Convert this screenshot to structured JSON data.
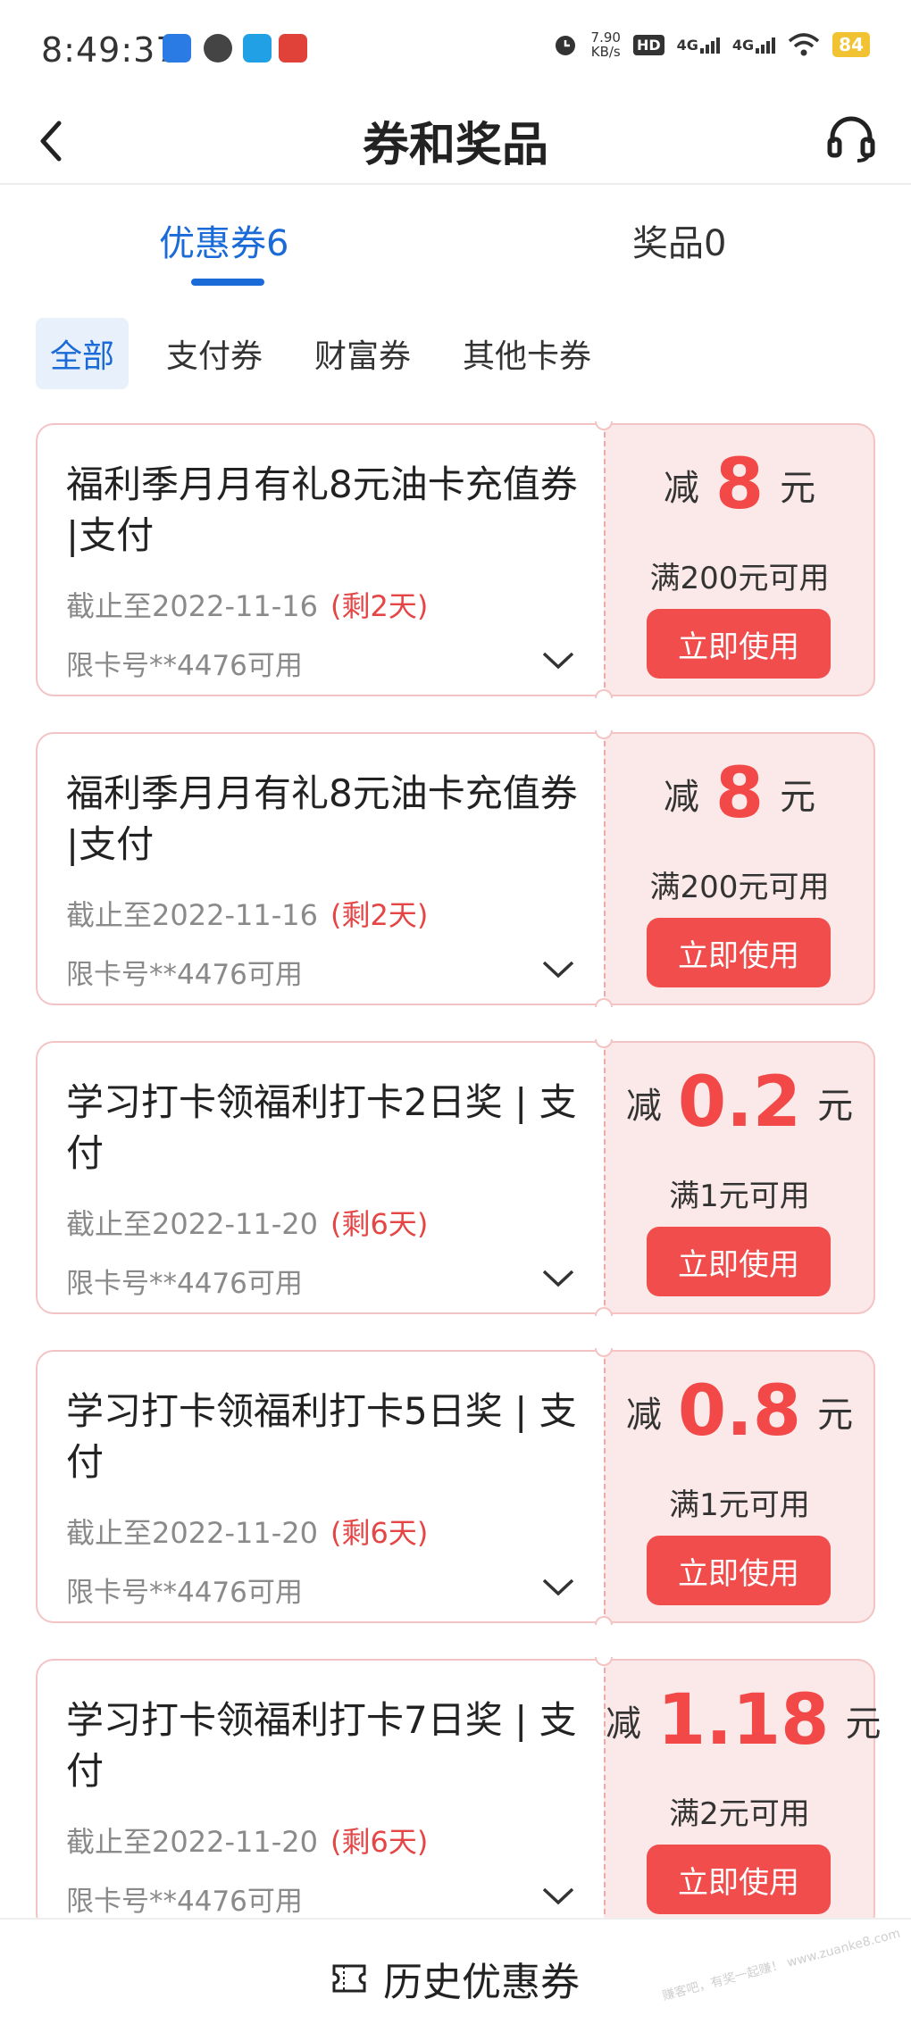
{
  "status_bar": {
    "time": "8:49:37",
    "net_speed_value": "7.90",
    "net_speed_unit": "KB/s",
    "hd": "HD",
    "signal1": "4G",
    "signal2": "4G",
    "battery": "84",
    "app_icons": [
      {
        "name": "app-icon-1",
        "color": "#2b7be4"
      },
      {
        "name": "app-icon-2",
        "color": "#444444"
      },
      {
        "name": "app-icon-3",
        "color": "#22a0e6"
      },
      {
        "name": "app-icon-4",
        "color": "#e0423a"
      }
    ]
  },
  "nav": {
    "title": "券和奖品"
  },
  "tabs": {
    "coupons": "优惠券6",
    "prizes": "奖品0"
  },
  "filters": [
    "全部",
    "支付券",
    "财富券",
    "其他卡券"
  ],
  "coupons": [
    {
      "title": "福利季月月有礼8元油卡充值券 |支付",
      "date": "截止至2022-11-16",
      "remain": "(剩2天)",
      "limit": "限卡号**4476可用",
      "prefix": "减",
      "amount": "8",
      "unit": "元",
      "condition": "满200元可用",
      "button": "立即使用"
    },
    {
      "title": "福利季月月有礼8元油卡充值券 |支付",
      "date": "截止至2022-11-16",
      "remain": "(剩2天)",
      "limit": "限卡号**4476可用",
      "prefix": "减",
      "amount": "8",
      "unit": "元",
      "condition": "满200元可用",
      "button": "立即使用"
    },
    {
      "title": "学习打卡领福利打卡2日奖 | 支付",
      "date": "截止至2022-11-20",
      "remain": "(剩6天)",
      "limit": "限卡号**4476可用",
      "prefix": "减",
      "amount": "0.2",
      "unit": "元",
      "condition": "满1元可用",
      "button": "立即使用"
    },
    {
      "title": "学习打卡领福利打卡5日奖 | 支付",
      "date": "截止至2022-11-20",
      "remain": "(剩6天)",
      "limit": "限卡号**4476可用",
      "prefix": "减",
      "amount": "0.8",
      "unit": "元",
      "condition": "满1元可用",
      "button": "立即使用"
    },
    {
      "title": "学习打卡领福利打卡7日奖 | 支付",
      "date": "截止至2022-11-20",
      "remain": "(剩6天)",
      "limit": "限卡号**4476可用",
      "prefix": "减",
      "amount": "1.18",
      "unit": "元",
      "condition": "满2元可用",
      "button": "立即使用"
    }
  ],
  "bottom": {
    "history_label": "历史优惠券",
    "watermark": "赚客吧，有奖一起赚！ www.zuanke8.com"
  },
  "colors": {
    "accent": "#1a6ad8",
    "coupon_red": "#f24848",
    "coupon_bg": "#fbe8e8"
  }
}
